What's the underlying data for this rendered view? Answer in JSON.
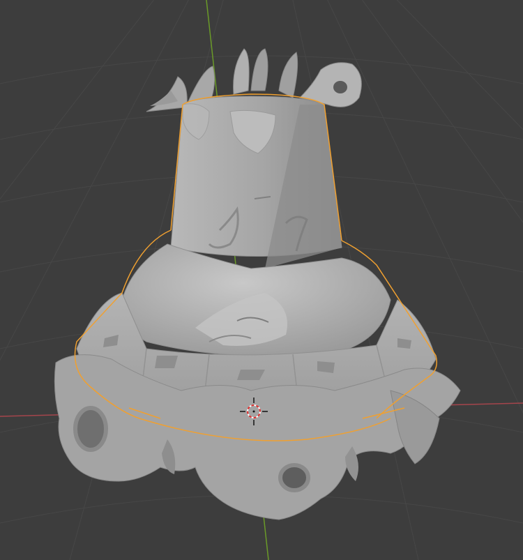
{
  "viewport": {
    "background_color": "#3d3d3d",
    "grid_color": "#4a4a4a",
    "axis_x_color": "#a5454c",
    "axis_y_color": "#6a9a28",
    "selection_outline_color": "#f0a030",
    "mesh_color": "#9a9a9a",
    "shading": "solid"
  },
  "object": {
    "shape": "bell-shaped sculpted mesh with holes and eroded surface",
    "selected": true
  },
  "cursor": {
    "icon": "3d-cursor-icon"
  }
}
